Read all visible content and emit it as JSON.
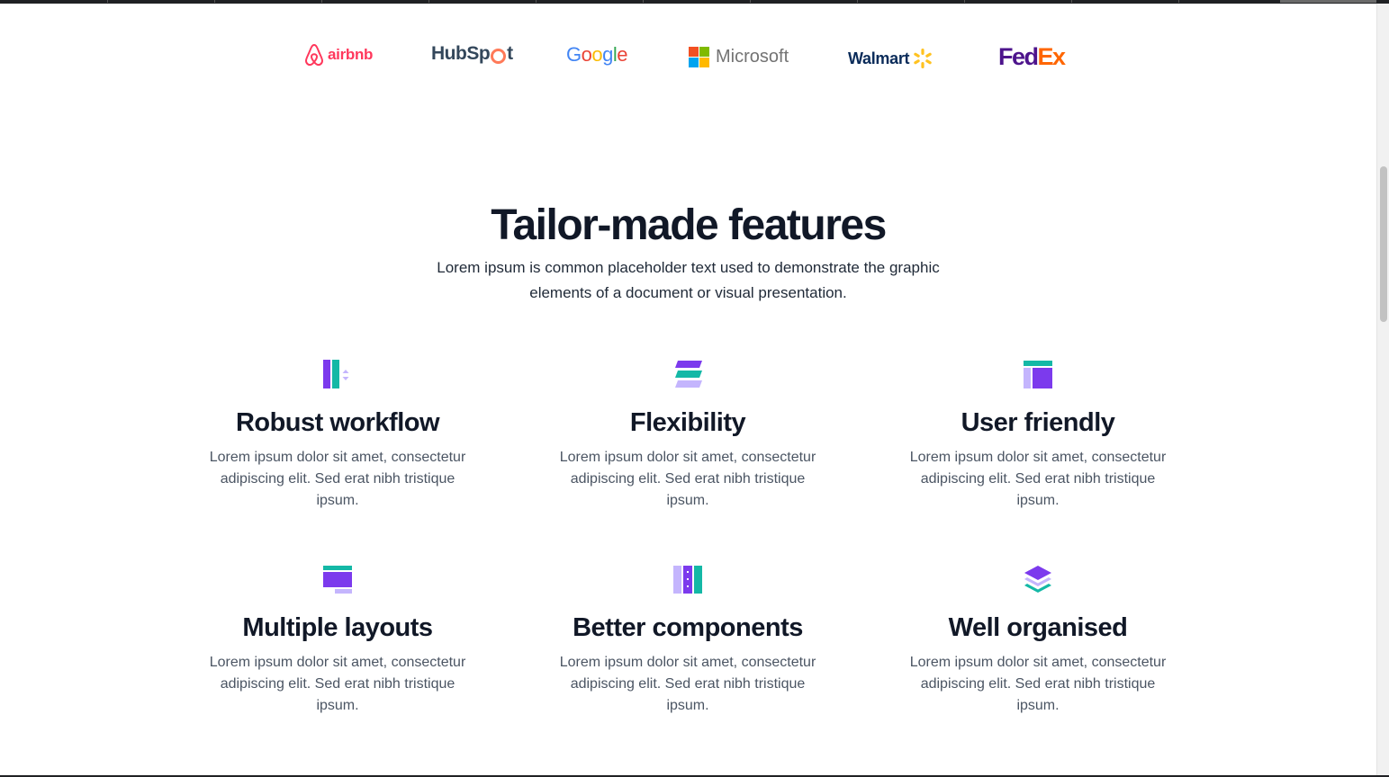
{
  "logos": {
    "airbnb": "airbnb",
    "hubspot_pre": "HubSp",
    "hubspot_post": "t",
    "google": [
      "G",
      "o",
      "o",
      "g",
      "l",
      "e"
    ],
    "google_colors": [
      "#4285F4",
      "#EA4335",
      "#FBBC05",
      "#4285F4",
      "#34A853",
      "#EA4335"
    ],
    "microsoft": "Microsoft",
    "microsoft_colors": [
      "#F25022",
      "#7FBA00",
      "#00A4EF",
      "#FFB900"
    ],
    "walmart": "Walmart",
    "walmart_spark_color": "#FFC220",
    "fedex_fed": "Fed",
    "fedex_ex": "Ex",
    "fedex_colors": [
      "#4D148C",
      "#FF6600"
    ]
  },
  "section": {
    "title": "Tailor-made features",
    "subtitle": "Lorem ipsum is common placeholder text used to demonstrate the graphic elements of a document or visual presentation."
  },
  "colors": {
    "purple": "#7C3AED",
    "teal": "#14B8A6",
    "lavender": "#C4B5FD",
    "heading": "#111827",
    "body": "#4B5563"
  },
  "features": [
    {
      "icon": "workflow-icon",
      "title": "Robust workflow",
      "text": "Lorem ipsum dolor sit amet, consectetur adipiscing elit. Sed erat nibh tristique ipsum."
    },
    {
      "icon": "flexibility-icon",
      "title": "Flexibility",
      "text": "Lorem ipsum dolor sit amet, consectetur adipiscing elit. Sed erat nibh tristique ipsum."
    },
    {
      "icon": "user-friendly-icon",
      "title": "User friendly",
      "text": "Lorem ipsum dolor sit amet, consectetur adipiscing elit. Sed erat nibh tristique ipsum."
    },
    {
      "icon": "layouts-icon",
      "title": "Multiple layouts",
      "text": "Lorem ipsum dolor sit amet, consectetur adipiscing elit. Sed erat nibh tristique ipsum."
    },
    {
      "icon": "components-icon",
      "title": "Better components",
      "text": "Lorem ipsum dolor sit amet, consectetur adipiscing elit. Sed erat nibh tristique ipsum."
    },
    {
      "icon": "layers-icon",
      "title": "Well organised",
      "text": "Lorem ipsum dolor sit amet, consectetur adipiscing elit. Sed erat nibh tristique ipsum."
    }
  ]
}
